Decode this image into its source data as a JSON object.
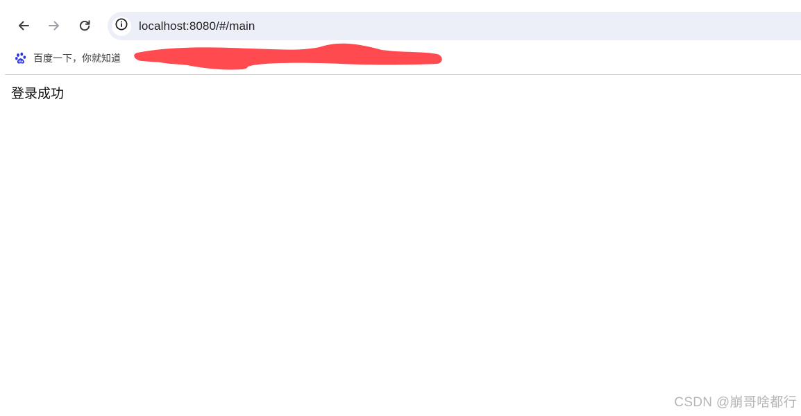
{
  "browser": {
    "url": "localhost:8080/#/main",
    "nav": {
      "back_icon": "arrow-left-icon",
      "forward_icon": "arrow-right-icon",
      "reload_icon": "reload-icon",
      "site_info_icon": "info-icon"
    }
  },
  "bookmarks": {
    "items": [
      {
        "label": "百度一下，你就知道",
        "icon": "baidu-paw-icon"
      }
    ],
    "redaction_color": "#ff4a4f"
  },
  "page": {
    "message": "登录成功"
  },
  "watermark": {
    "text": "CSDN @崩哥啥都行"
  },
  "colors": {
    "omnibox_bg": "#eceff8",
    "baidu_blue": "#2932e1",
    "forward_disabled": "#9aa0a6"
  }
}
